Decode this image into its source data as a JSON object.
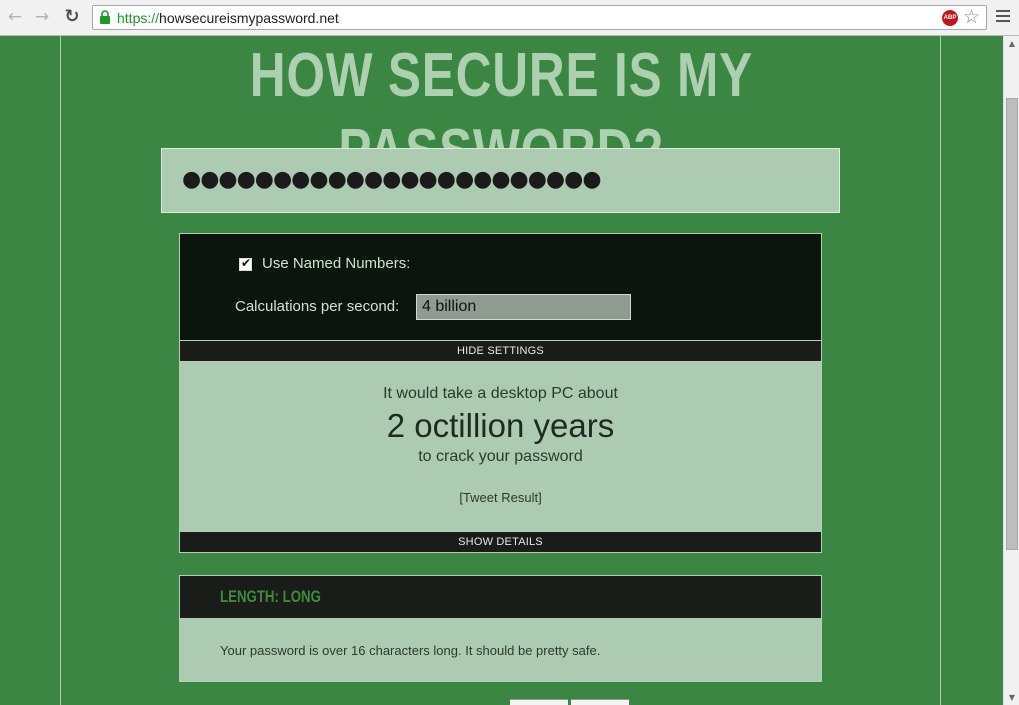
{
  "browser": {
    "url_protocol": "https://",
    "url_rest": "howsecureismypassword.net",
    "back_icon": "arrow-left-icon",
    "forward_icon": "arrow-right-icon",
    "reload_icon": "reload-icon",
    "adblock_label": "ABP"
  },
  "page": {
    "headline": "HOW SECURE IS MY PASSWORD?",
    "password_masked": "●●●●●●●●●●●●●●●●●●●●●●●",
    "settings": {
      "named_numbers_label": "Use Named Numbers:",
      "named_numbers_checked": true,
      "calc_label": "Calculations per second:",
      "calc_value": "4 billion",
      "hide_label": "HIDE SETTINGS"
    },
    "result": {
      "intro": "It would take a desktop PC about",
      "time": "2 octillion years",
      "outro": "to crack your password",
      "tweet": "[Tweet Result]",
      "show_details_label": "SHOW DETAILS"
    },
    "length": {
      "title": "LENGTH: LONG",
      "text": "Your password is over 16 characters long. It should be pretty safe."
    }
  },
  "colors": {
    "background": "#3a8642",
    "headline": "#acd0b0",
    "panel_light": "#adcbb1",
    "panel_dark": "#0b140d",
    "length_title": "#3f8a3c"
  }
}
